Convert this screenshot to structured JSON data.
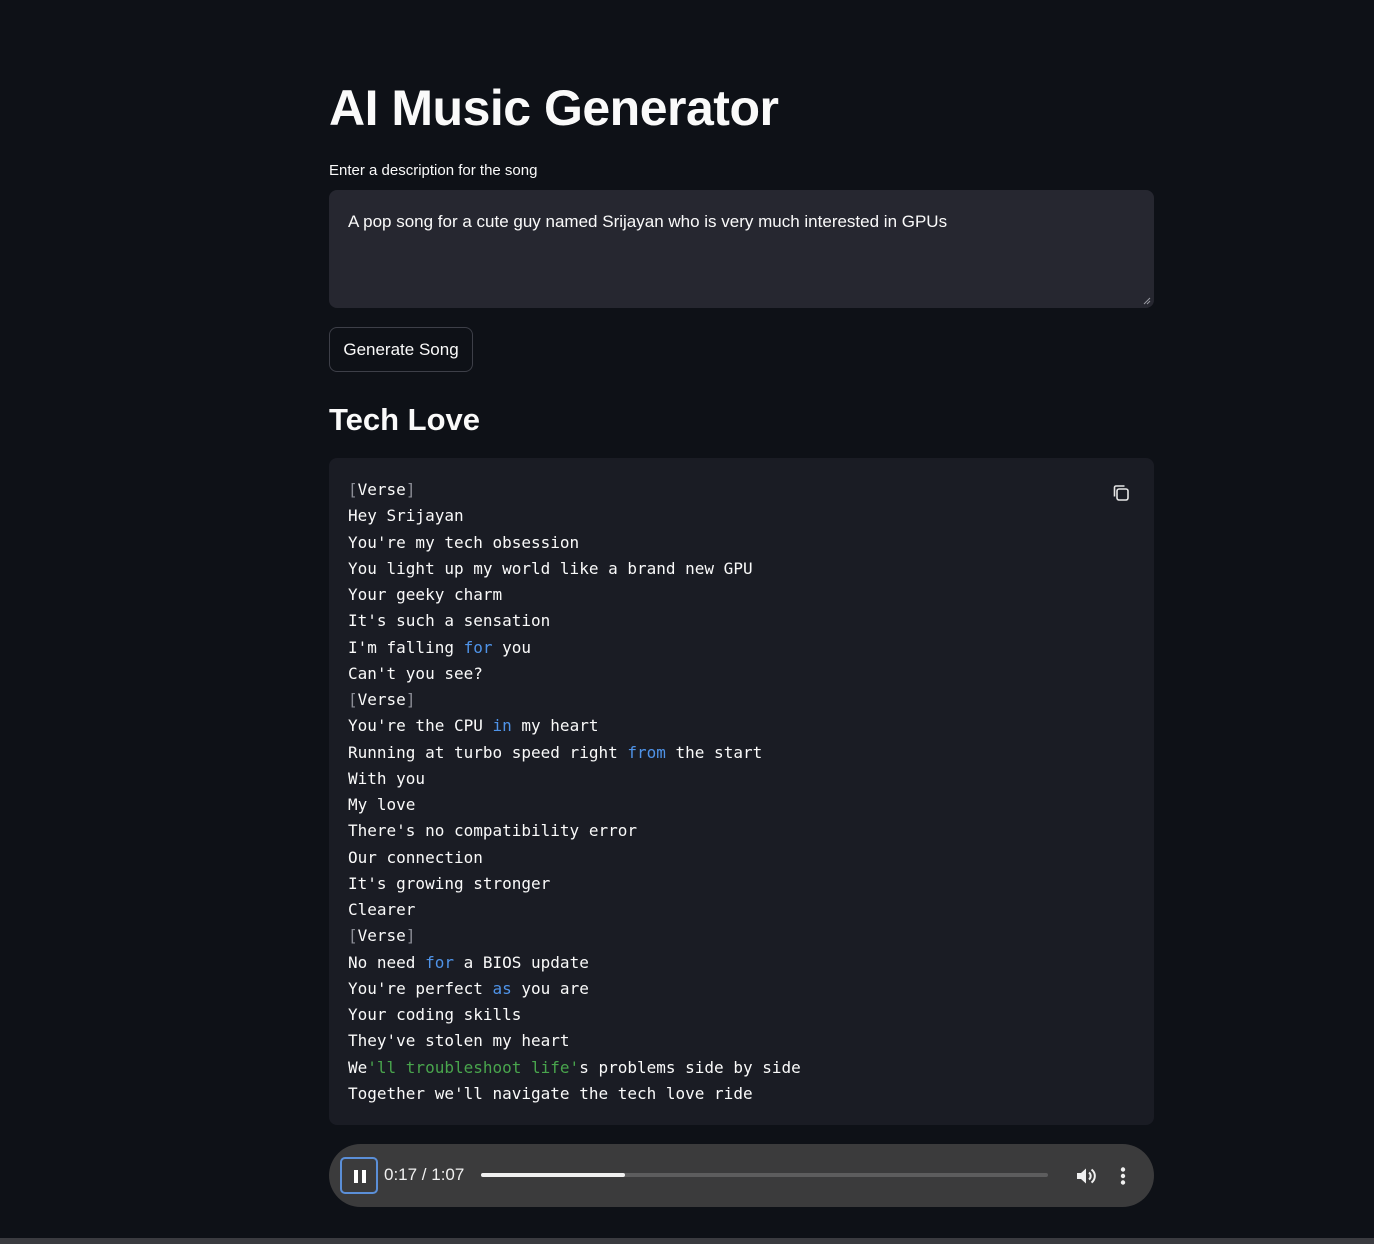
{
  "page": {
    "title": "AI Music Generator",
    "background": "#0e1117"
  },
  "input": {
    "label": "Enter a description for the song",
    "value": "A pop song for a cute guy named Srijayan who is very much interested in GPUs"
  },
  "generate_button": {
    "label": "Generate Song"
  },
  "song": {
    "title": "Tech Love",
    "copy_icon": "copy-icon",
    "lyrics": [
      [
        {
          "t": "[",
          "c": "br"
        },
        {
          "t": "Verse"
        },
        {
          "t": "]",
          "c": "br"
        }
      ],
      [
        {
          "t": "Hey Srijayan"
        }
      ],
      [
        {
          "t": "You're my tech obsession"
        }
      ],
      [
        {
          "t": "You light up my world like a brand new GPU"
        }
      ],
      [
        {
          "t": "Your geeky charm"
        }
      ],
      [
        {
          "t": "It's such a sensation"
        }
      ],
      [
        {
          "t": "I'm falling "
        },
        {
          "t": "for",
          "c": "kw"
        },
        {
          "t": " you"
        }
      ],
      [
        {
          "t": "Can't you see?"
        }
      ],
      [
        {
          "t": "[",
          "c": "br"
        },
        {
          "t": "Verse"
        },
        {
          "t": "]",
          "c": "br"
        }
      ],
      [
        {
          "t": "You're the CPU "
        },
        {
          "t": "in",
          "c": "kw"
        },
        {
          "t": " my heart"
        }
      ],
      [
        {
          "t": "Running at turbo speed right "
        },
        {
          "t": "from",
          "c": "kw"
        },
        {
          "t": " the start"
        }
      ],
      [
        {
          "t": "With you"
        }
      ],
      [
        {
          "t": "My love"
        }
      ],
      [
        {
          "t": "There's no compatibility error"
        }
      ],
      [
        {
          "t": "Our connection"
        }
      ],
      [
        {
          "t": "It's growing stronger"
        }
      ],
      [
        {
          "t": "Clearer"
        }
      ],
      [
        {
          "t": "[",
          "c": "br"
        },
        {
          "t": "Verse"
        },
        {
          "t": "]",
          "c": "br"
        }
      ],
      [
        {
          "t": "No need "
        },
        {
          "t": "for",
          "c": "kw"
        },
        {
          "t": " a BIOS update"
        }
      ],
      [
        {
          "t": "You're perfect "
        },
        {
          "t": "as",
          "c": "kw"
        },
        {
          "t": " you are"
        }
      ],
      [
        {
          "t": "Your coding skills"
        }
      ],
      [
        {
          "t": "They've stolen my heart"
        }
      ],
      [
        {
          "t": "We"
        },
        {
          "t": "'ll troubleshoot life'",
          "c": "str"
        },
        {
          "t": "s problems side by side"
        }
      ],
      [
        {
          "t": "Together we'll navigate the tech love ride"
        }
      ]
    ]
  },
  "audio_player": {
    "time": "0:17 / 1:07",
    "progress_fraction": 0.2537,
    "play_state_icon": "pause-icon",
    "volume_icon": "volume-icon",
    "more_icon": "more-vert-icon"
  },
  "colors": {
    "keyword": "#4f93e8",
    "string": "#49a54d",
    "player_bg": "#3b3b3c",
    "focus_ring": "#5b8fd8"
  }
}
